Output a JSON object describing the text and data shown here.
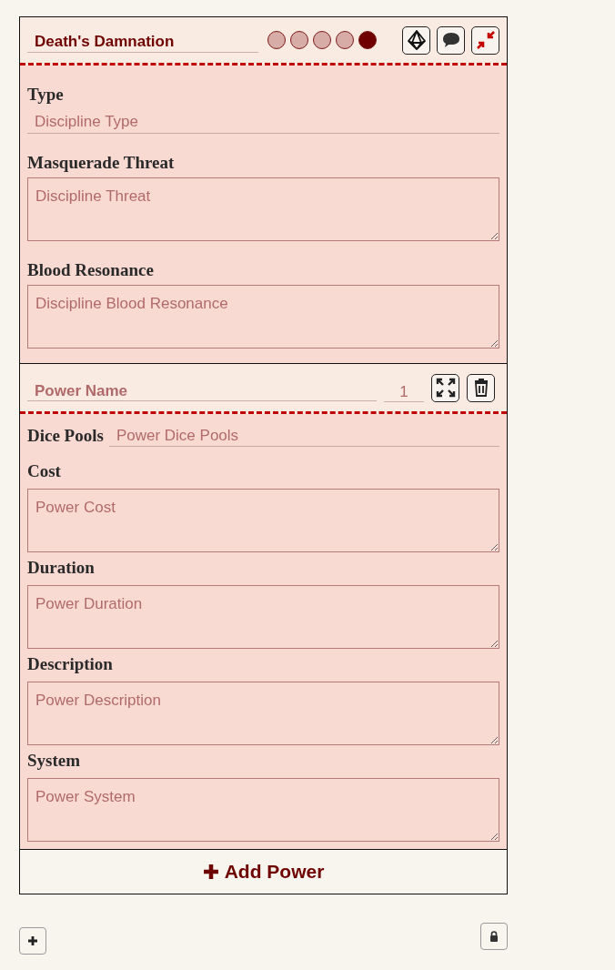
{
  "discipline": {
    "name": "Death's Damnation",
    "dots": [
      {
        "checked": false
      },
      {
        "checked": false
      },
      {
        "checked": false
      },
      {
        "checked": false
      },
      {
        "checked": true
      }
    ],
    "fields": [
      {
        "label": "Type",
        "kind": "line",
        "placeholder": "Discipline Type"
      },
      {
        "label": "Masquerade Threat",
        "kind": "area",
        "placeholder": "Discipline Threat"
      },
      {
        "label": "Blood Resonance",
        "kind": "area",
        "placeholder": "Discipline Blood Resonance"
      }
    ]
  },
  "powers": [
    {
      "name_placeholder": "Power Name",
      "level_placeholder": "1",
      "fields": [
        {
          "label": "Dice Pools",
          "kind": "inline",
          "placeholder": "Power Dice Pools"
        },
        {
          "label": "Cost",
          "kind": "area",
          "placeholder": "Power Cost"
        },
        {
          "label": "Duration",
          "kind": "area",
          "placeholder": "Power Duration"
        },
        {
          "label": "Description",
          "kind": "area",
          "placeholder": "Power Description"
        },
        {
          "label": "System",
          "kind": "area",
          "placeholder": "Power System"
        }
      ]
    }
  ],
  "add_power_label": "Add Power"
}
